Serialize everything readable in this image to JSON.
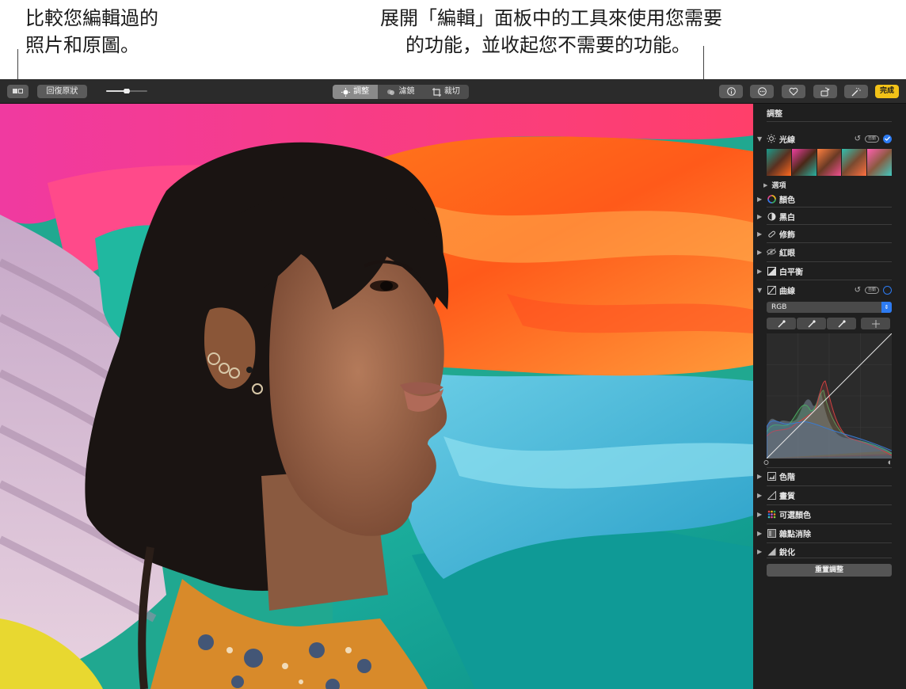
{
  "callouts": {
    "compare": {
      "line1": "比較您編輯過的",
      "line2": "照片和原圖。"
    },
    "panel": {
      "line1": "展開「編輯」面板中的工具來使用您需要",
      "line2": "的功能，並收起您不需要的功能。"
    }
  },
  "toolbar": {
    "compare_icon": "compare-icon",
    "revert_label": "回復原狀",
    "tabs": [
      {
        "label": "調整",
        "icon": "adjust-icon",
        "active": true
      },
      {
        "label": "濾鏡",
        "icon": "filters-icon",
        "active": false
      },
      {
        "label": "裁切",
        "icon": "crop-icon",
        "active": false
      }
    ],
    "right_icons": [
      "info-icon",
      "more-icon",
      "heart-icon",
      "rotate-icon",
      "enhance-icon"
    ],
    "done_label": "完成"
  },
  "sidebar": {
    "title": "調整",
    "light": {
      "label": "光線",
      "options_label": "選項",
      "auto": "自動"
    },
    "items": [
      {
        "label": "顏色",
        "icon": "color-wheel-icon"
      },
      {
        "label": "黑白",
        "icon": "bw-circle-icon"
      },
      {
        "label": "修飾",
        "icon": "bandage-icon"
      },
      {
        "label": "紅眼",
        "icon": "redeye-icon"
      },
      {
        "label": "白平衡",
        "icon": "white-balance-icon"
      }
    ],
    "curves": {
      "label": "曲線",
      "auto": "自動",
      "channel": "RGB"
    },
    "items2": [
      {
        "label": "色階",
        "icon": "levels-icon"
      },
      {
        "label": "畫質",
        "icon": "definition-icon"
      },
      {
        "label": "可選顏色",
        "icon": "selective-color-icon"
      },
      {
        "label": "雜點消除",
        "icon": "noise-icon"
      },
      {
        "label": "銳化",
        "icon": "sharpen-icon"
      }
    ],
    "reset_label": "重置調整"
  },
  "colors": {
    "accent": "#2d7bf2",
    "done": "#f2c218",
    "toolbar": "#2b2b2b",
    "panel": "#1f1f1f"
  }
}
